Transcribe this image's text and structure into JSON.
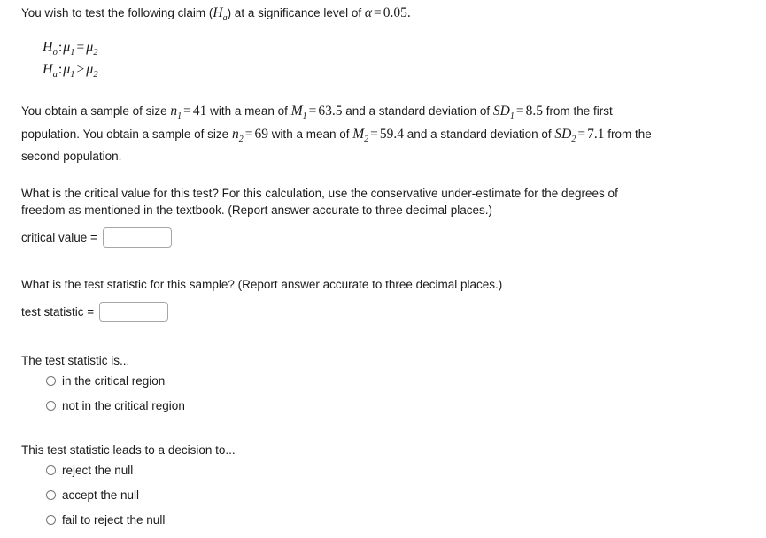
{
  "intro": {
    "text_before": "You wish to test the following claim (",
    "claim_symbol": "H",
    "claim_sub": "a",
    "text_mid": ") at a significance level of ",
    "alpha": "α",
    "equals": "=",
    "alpha_value": "0.05."
  },
  "hypotheses": {
    "null": {
      "label": "H",
      "label_sub": "o",
      "colon": ":",
      "left": "μ",
      "left_sub": "1",
      "operator": "=",
      "right": "μ",
      "right_sub": "2"
    },
    "alt": {
      "label": "H",
      "label_sub": "a",
      "colon": ":",
      "left": "μ",
      "left_sub": "1",
      "operator": ">",
      "right": "μ",
      "right_sub": "2"
    }
  },
  "sample": {
    "s1": "You obtain a sample of size ",
    "n1_sym": "n",
    "n1_sub": "1",
    "eq1": "=",
    "n1_val": "41",
    "s2": " with a mean of ",
    "m1_sym": "M",
    "m1_sub": "1",
    "eq2": "=",
    "m1_val": "63.5",
    "s3": " and a standard deviation of ",
    "sd1_sym": "SD",
    "sd1_sub": "1",
    "eq3": "=",
    "sd1_val": "8.5",
    "s4": " from the first population. You obtain a sample of size ",
    "n2_sym": "n",
    "n2_sub": "2",
    "eq4": "=",
    "n2_val": "69",
    "s5": " with a mean of ",
    "m2_sym": "M",
    "m2_sub": "2",
    "eq5": "=",
    "m2_val": "59.4",
    "s6": " and a standard deviation of ",
    "sd2_sym": "SD",
    "sd2_sub": "2",
    "eq6": "=",
    "sd2_val": "7.1",
    "s7": " from the second population."
  },
  "critical_value_question": {
    "prompt": "What is the critical value for this test? For this calculation, use the conservative under-estimate for the degrees of freedom as mentioned in the textbook. (Report answer accurate to three decimal places.)",
    "label": "critical value =",
    "value": "",
    "placeholder": ""
  },
  "test_statistic_question": {
    "prompt": "What is the test statistic for this sample? (Report answer accurate to three decimal places.)",
    "label": "test statistic =",
    "value": "",
    "placeholder": ""
  },
  "critical_region_question": {
    "prompt": "The test statistic is...",
    "options": [
      {
        "label": "in the critical region",
        "selected": false
      },
      {
        "label": "not in the critical region",
        "selected": false
      }
    ]
  },
  "decision_question": {
    "prompt": "This test statistic leads to a decision to...",
    "options": [
      {
        "label": "reject the null",
        "selected": false
      },
      {
        "label": "accept the null",
        "selected": false
      },
      {
        "label": "fail to reject the null",
        "selected": false
      }
    ]
  },
  "colors": {
    "background": "#ffffff",
    "text": "#1a1a1a",
    "input_border": "#a6a6a6",
    "radio_border": "#767676"
  }
}
